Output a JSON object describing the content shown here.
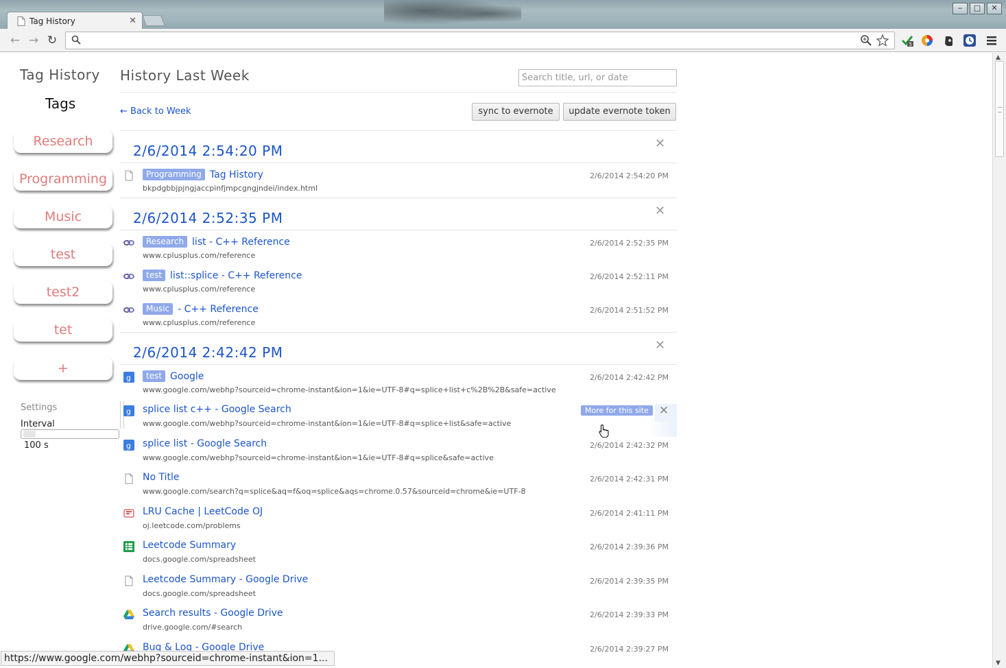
{
  "browser": {
    "tab_title": "Tag History",
    "omnibox_value": ""
  },
  "sidebar": {
    "app_title": "Tag History",
    "tags_heading": "Tags",
    "tags": [
      {
        "label": "Research"
      },
      {
        "label": "Programming"
      },
      {
        "label": "Music"
      },
      {
        "label": "test"
      },
      {
        "label": "test2"
      },
      {
        "label": "tet"
      },
      {
        "label": "+"
      }
    ],
    "settings_label": "Settings",
    "interval_label": "Interval",
    "interval_value": "100 s"
  },
  "main": {
    "title": "History Last Week",
    "search_placeholder": "Search title, url, or date",
    "back_link": "← Back to Week",
    "sync_button": "sync to evernote",
    "update_button": "update evernote token",
    "more_for_site": "More for this site",
    "groups": [
      {
        "header": "2/6/2014 2:54:20 PM",
        "entries": [
          {
            "icon": "page-icon",
            "tag": "Programming",
            "title": "Tag History",
            "url": "bkpdgbbjpjngjaccpinfjmpcgngjndei/index.html",
            "time": "2/6/2014 2:54:20 PM"
          }
        ]
      },
      {
        "header": "2/6/2014 2:52:35 PM",
        "entries": [
          {
            "icon": "cplusplus-icon",
            "tag": "Research",
            "title": "list - C++ Reference",
            "url": "www.cplusplus.com/reference",
            "time": "2/6/2014 2:52:35 PM"
          },
          {
            "icon": "cplusplus-icon",
            "tag": "test",
            "title": "list::splice - C++ Reference",
            "url": "www.cplusplus.com/reference",
            "time": "2/6/2014 2:52:11 PM"
          },
          {
            "icon": "cplusplus-icon",
            "tag": "Music",
            "title": "- C++ Reference",
            "url": "www.cplusplus.com/reference",
            "time": "2/6/2014 2:51:52 PM"
          }
        ]
      },
      {
        "header": "2/6/2014 2:42:42 PM",
        "entries": [
          {
            "icon": "google-icon",
            "tag": "test",
            "title": "Google",
            "url": "www.google.com/webhp?sourceid=chrome-instant&ion=1&ie=UTF-8#q=splice+list+c%2B%2B&safe=active",
            "time": "2/6/2014 2:42:42 PM"
          },
          {
            "icon": "google-icon",
            "tag": "",
            "title": "splice list c++ - Google Search",
            "url": "www.google.com/webhp?sourceid=chrome-instant&ion=1&ie=UTF-8#q=splice+list&safe=active",
            "time": ""
          },
          {
            "icon": "google-icon",
            "tag": "",
            "title": "splice list - Google Search",
            "url": "www.google.com/webhp?sourceid=chrome-instant&ion=1&ie=UTF-8#q=splice&safe=active",
            "time": "2/6/2014 2:42:32 PM"
          },
          {
            "icon": "page-icon",
            "tag": "",
            "title": "No Title",
            "url": "www.google.com/search?q=splice&aq=f&oq=splice&aqs=chrome.0.57&sourceid=chrome&ie=UTF-8",
            "time": "2/6/2014 2:42:31 PM"
          },
          {
            "icon": "leetcode-icon",
            "tag": "",
            "title": "LRU Cache | LeetCode OJ",
            "url": "oj.leetcode.com/problems",
            "time": "2/6/2014 2:41:11 PM"
          },
          {
            "icon": "spreadsheet-icon",
            "tag": "",
            "title": "Leetcode Summary",
            "url": "docs.google.com/spreadsheet",
            "time": "2/6/2014 2:39:36 PM"
          },
          {
            "icon": "page-icon",
            "tag": "",
            "title": "Leetcode Summary - Google Drive",
            "url": "docs.google.com/spreadsheet",
            "time": "2/6/2014 2:39:35 PM"
          },
          {
            "icon": "drive-icon",
            "tag": "",
            "title": "Search results - Google Drive",
            "url": "drive.google.com/#search",
            "time": "2/6/2014 2:39:33 PM"
          },
          {
            "icon": "drive-icon",
            "tag": "",
            "title": "Bug & Log - Google Drive",
            "url": "",
            "time": "2/6/2014 2:39:27 PM"
          }
        ]
      }
    ]
  },
  "statusbar": {
    "text": "https://www.google.com/webhp?sourceid=chrome-instant&ion=1..."
  }
}
